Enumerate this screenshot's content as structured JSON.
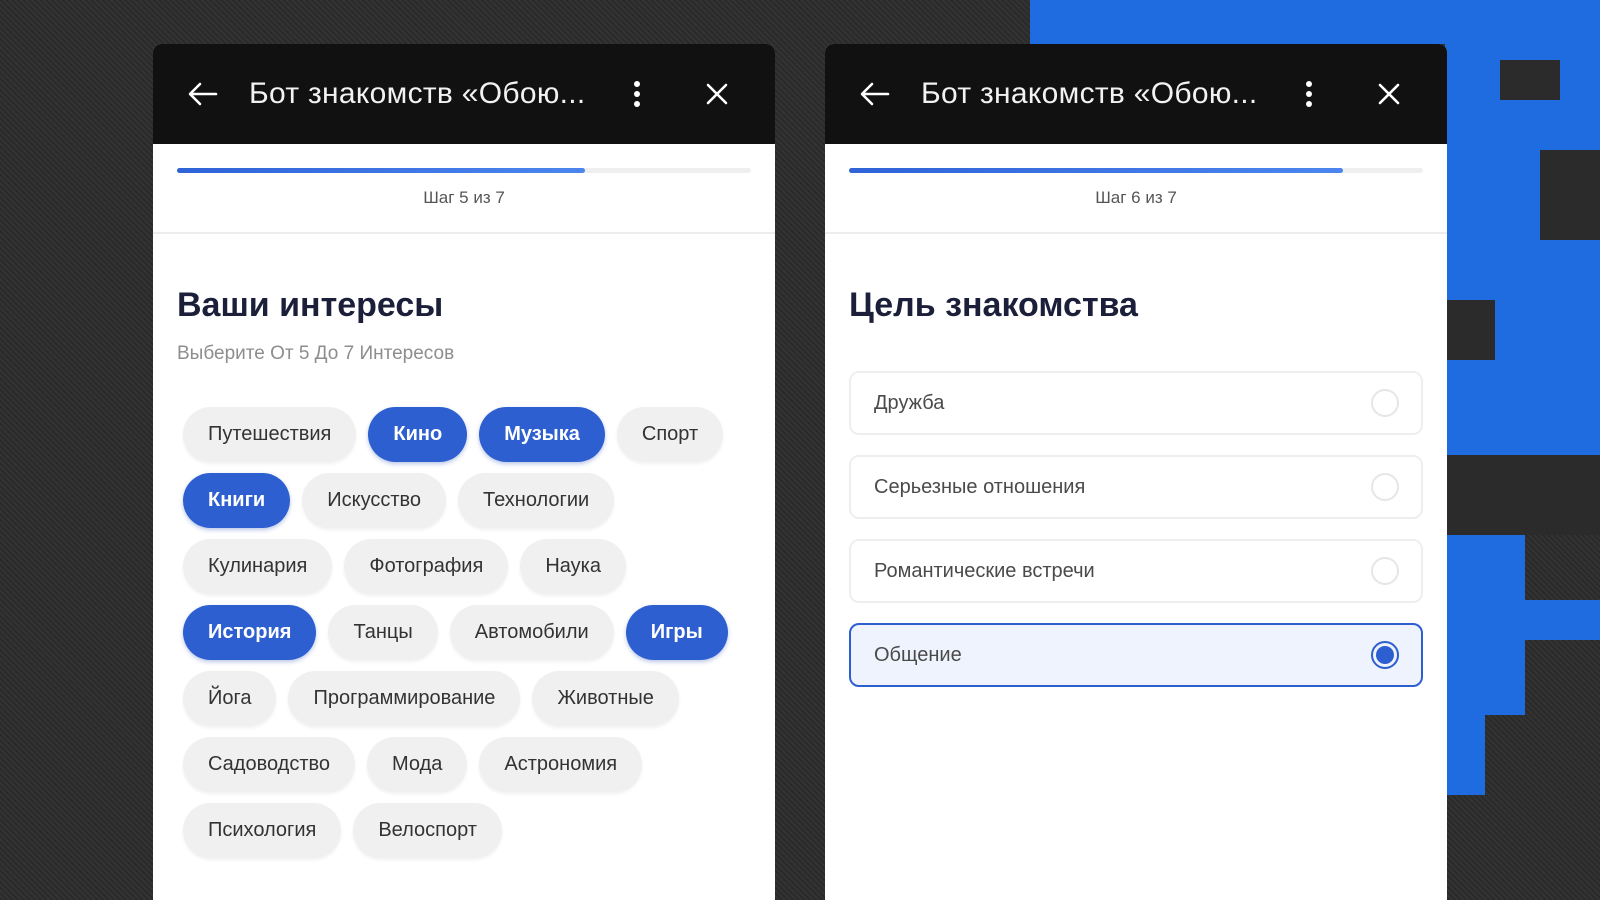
{
  "colors": {
    "accent": "#2e5fd0",
    "titlebar": "#111111",
    "heading": "#1b1f3a"
  },
  "panels": [
    {
      "header": {
        "back_icon": "arrow-left-icon",
        "title": "Бот знакомств «Обою...",
        "menu_icon": "kebab-menu-icon",
        "close_icon": "close-icon"
      },
      "progress": {
        "value": 0.71,
        "label": "Шаг 5 из 7"
      },
      "heading": "Ваши интересы",
      "subheading": "Выберите От 5 До 7 Интересов",
      "chips": [
        {
          "label": "Путешествия",
          "selected": false
        },
        {
          "label": "Кино",
          "selected": true
        },
        {
          "label": "Музыка",
          "selected": true
        },
        {
          "label": "Спорт",
          "selected": false
        },
        {
          "label": "Книги",
          "selected": true
        },
        {
          "label": "Искусство",
          "selected": false
        },
        {
          "label": "Технологии",
          "selected": false
        },
        {
          "label": "Кулинария",
          "selected": false
        },
        {
          "label": "Фотография",
          "selected": false
        },
        {
          "label": "Наука",
          "selected": false
        },
        {
          "label": "История",
          "selected": true
        },
        {
          "label": "Танцы",
          "selected": false
        },
        {
          "label": "Автомобили",
          "selected": false
        },
        {
          "label": "Игры",
          "selected": true
        },
        {
          "label": "Йога",
          "selected": false
        },
        {
          "label": "Программирование",
          "selected": false
        },
        {
          "label": "Животные",
          "selected": false
        },
        {
          "label": "Садоводство",
          "selected": false
        },
        {
          "label": "Мода",
          "selected": false
        },
        {
          "label": "Астрономия",
          "selected": false
        },
        {
          "label": "Психология",
          "selected": false
        },
        {
          "label": "Велоспорт",
          "selected": false
        }
      ]
    },
    {
      "header": {
        "back_icon": "arrow-left-icon",
        "title": "Бот знакомств «Обою...",
        "menu_icon": "kebab-menu-icon",
        "close_icon": "close-icon"
      },
      "progress": {
        "value": 0.86,
        "label": "Шаг 6 из 7"
      },
      "heading": "Цель знакомства",
      "options": [
        {
          "label": "Дружба",
          "selected": false
        },
        {
          "label": "Серьезные отношения",
          "selected": false
        },
        {
          "label": "Романтические встречи",
          "selected": false
        },
        {
          "label": "Общение",
          "selected": true
        }
      ]
    }
  ]
}
